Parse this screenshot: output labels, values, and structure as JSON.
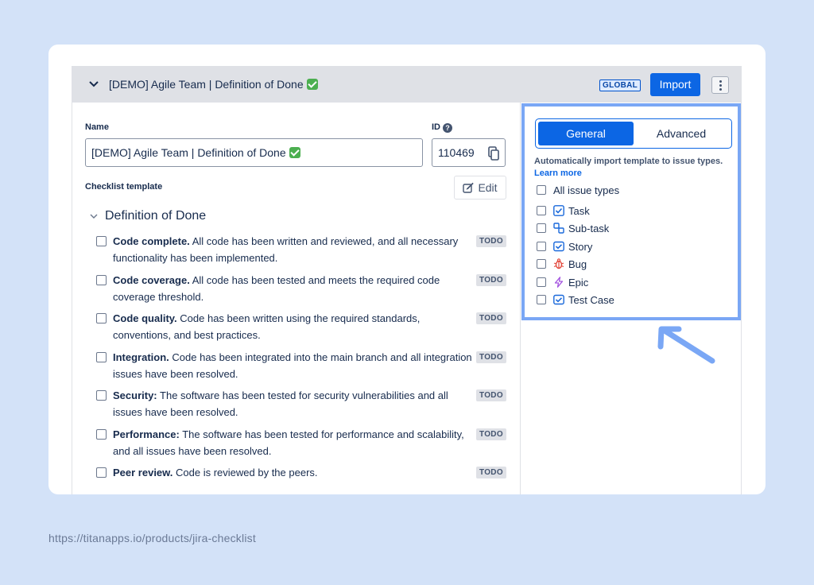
{
  "header": {
    "title": "[DEMO] Agile Team | Definition of Done",
    "scope_badge": "GLOBAL",
    "import_label": "Import"
  },
  "form": {
    "name_label": "Name",
    "name_value": "[DEMO] Agile Team | Definition of Done",
    "id_label": "ID",
    "id_value": "110469",
    "template_label": "Checklist template",
    "edit_label": "Edit"
  },
  "checklist": {
    "section_title": "Definition of Done",
    "items": [
      {
        "title": "Code complete.",
        "text": "All code has been written and reviewed, and all necessary functionality has been implemented.",
        "status": "TODO"
      },
      {
        "title": "Code coverage.",
        "text": "All code has been tested and meets the required code coverage threshold.",
        "status": "TODO"
      },
      {
        "title": "Code quality.",
        "text": "Code has been written using the required standards, conventions, and best practices.",
        "status": "TODO"
      },
      {
        "title": "Integration.",
        "text": "Code has been integrated into the main branch and all integration issues have been resolved.",
        "status": "TODO"
      },
      {
        "title": "Security:",
        "text": "The software has been tested for security vulnerabilities and all issues have been resolved.",
        "status": "TODO"
      },
      {
        "title": "Performance:",
        "text": "The software has been tested for performance and scalability, and all issues have been resolved.",
        "status": "TODO"
      },
      {
        "title": "Peer review.",
        "text": "Code is reviewed by the peers.",
        "status": "TODO"
      }
    ]
  },
  "import_settings": {
    "tabs": [
      "General",
      "Advanced"
    ],
    "active_tab": "General",
    "description": "Automatically import template to issue types.",
    "learn_more": "Learn more",
    "all_label": "All issue types",
    "issue_types": [
      {
        "label": "Task",
        "icon": "task-icon"
      },
      {
        "label": "Sub-task",
        "icon": "subtask-icon"
      },
      {
        "label": "Story",
        "icon": "story-icon"
      },
      {
        "label": "Bug",
        "icon": "bug-icon"
      },
      {
        "label": "Epic",
        "icon": "epic-icon"
      },
      {
        "label": "Test Case",
        "icon": "test-case-icon"
      }
    ]
  },
  "footer": {
    "url": "https://titanapps.io/products/jira-checklist"
  },
  "colors": {
    "background": "#d3e2f8",
    "primary": "#0c66e4",
    "highlight": "#7aa7f5"
  }
}
